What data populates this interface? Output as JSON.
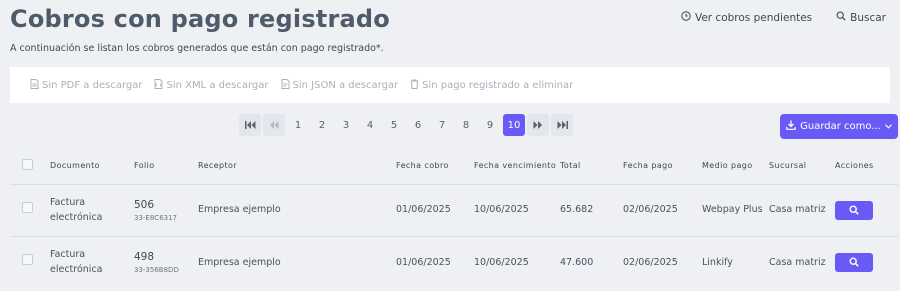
{
  "header": {
    "title": "Cobros con pago registrado",
    "subtitle": "A continuación se listan los cobros generados que están con pago registrado*.",
    "pending_link": "Ver cobros pendientes",
    "search_link": "Buscar"
  },
  "toolbar": {
    "pdf": "Sin PDF a descargar",
    "xml": "Sin XML a descargar",
    "json": "Sin JSON a descargar",
    "delete": "Sin pago registrado a eliminar"
  },
  "pagination": {
    "pages": [
      "1",
      "2",
      "3",
      "4",
      "5",
      "6",
      "7",
      "8",
      "9",
      "10"
    ],
    "current": "10"
  },
  "save_button": {
    "label": "Guardar como..."
  },
  "table": {
    "headers": {
      "documento": "Documento",
      "folio": "Folio",
      "receptor": "Receptor",
      "fecha_cobro": "Fecha cobro",
      "fecha_vencimiento": "Fecha vencimiento",
      "total": "Total",
      "fecha_pago": "Fecha pago",
      "medio_pago": "Medio pago",
      "sucursal": "Sucursal",
      "acciones": "Acciones"
    },
    "rows": [
      {
        "documento": "Factura electrónica",
        "folio": "506",
        "folio_code": "33-E8C6317",
        "receptor": "Empresa ejemplo",
        "fecha_cobro": "01/06/2025",
        "fecha_vencimiento": "10/06/2025",
        "total": "65.682",
        "fecha_pago": "02/06/2025",
        "medio_pago": "Webpay Plus",
        "sucursal": "Casa matriz"
      },
      {
        "documento": "Factura electrónica",
        "folio": "498",
        "folio_code": "33-356B8DD",
        "receptor": "Empresa ejemplo",
        "fecha_cobro": "01/06/2025",
        "fecha_vencimiento": "10/06/2025",
        "total": "47.600",
        "fecha_pago": "02/06/2025",
        "medio_pago": "Linkify",
        "sucursal": "Casa matriz"
      }
    ]
  },
  "colors": {
    "accent": "#6a5af5",
    "background": "#eef0f4",
    "title": "#4f5a6b"
  }
}
